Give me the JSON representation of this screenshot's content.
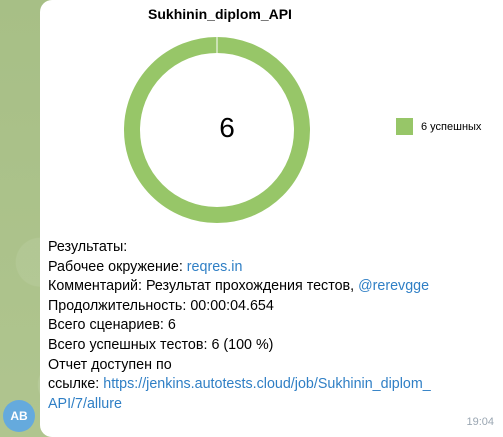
{
  "chat": {
    "avatar_initials": "AB",
    "time": "19:04"
  },
  "chart": {
    "title": "Sukhinin_diplom_API",
    "center_value": "6",
    "legend_label": "6 успешных",
    "color": "#97c668"
  },
  "chart_data": {
    "type": "pie",
    "title": "Sukhinin_diplom_API",
    "categories": [
      "успешных"
    ],
    "values": [
      6
    ],
    "center_label": "6",
    "legend_position": "right"
  },
  "message": {
    "results_label": "Результаты:",
    "env_label": "Рабочее окружение:",
    "env_value": "reqres.in",
    "comment_label": "Комментарий:",
    "comment_text": "Результат прохождения тестов,",
    "comment_mention": "@rerevgge",
    "duration_label": "Продолжительность:",
    "duration_value": "00:00:04.654",
    "scenarios_label": "Всего сценариев:",
    "scenarios_value": "6",
    "passed_label": "Всего успешных тестов:",
    "passed_value": "6 (100 %)",
    "report_line1": "Отчет доступен по",
    "report_line2_label": "ссылке:",
    "report_url_part1": "https://jenkins.autotests.cloud/job/Sukhinin_diplom_",
    "report_url_part2": "API/7/allure"
  }
}
